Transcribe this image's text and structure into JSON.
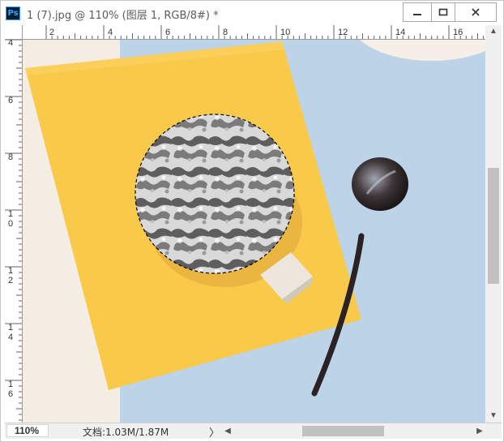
{
  "window": {
    "app_icon": "Ps",
    "title": "1 (7).jpg @ 110% (图层 1, RGB/8#) *"
  },
  "ruler": {
    "h_labels": [
      "2",
      "4",
      "6",
      "8",
      "10",
      "12",
      "14",
      "16"
    ],
    "v_labels": [
      "4",
      "6",
      "8",
      "1\n0",
      "1\n2",
      "1\n4",
      "1\n6"
    ]
  },
  "status": {
    "zoom": "110%",
    "doc_info": "文档:1.03M/1.87M",
    "arrow": "〉"
  },
  "colors": {
    "background_blue": "#bcd3e8",
    "notebook_yellow": "#f9c94a",
    "selection": "#000000"
  },
  "icons": {
    "minimize": "minimize-icon",
    "maximize": "maximize-icon",
    "close": "close-icon"
  }
}
